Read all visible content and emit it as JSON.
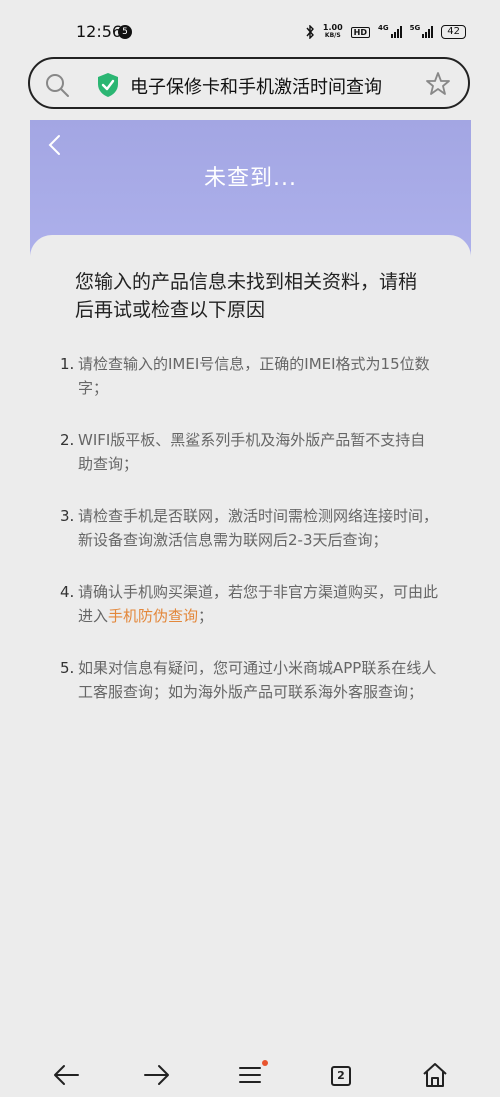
{
  "status_bar": {
    "time": "12:56",
    "notification_count": "5",
    "net_speed": "1.00",
    "net_unit": "KB/S",
    "hd": "HD",
    "sig1": "4G",
    "sig2": "5G",
    "battery": "42"
  },
  "address_bar": {
    "title": "电子保修卡和手机激活时间查询"
  },
  "hero": {
    "title": "未查到..."
  },
  "content": {
    "heading": "您输入的产品信息未找到相关资料，请稍后再试或检查以下原因",
    "items": [
      {
        "num": "1.",
        "text": "请检查输入的IMEI号信息，正确的IMEI格式为15位数字；"
      },
      {
        "num": "2.",
        "text": "WIFI版平板、黑鲨系列手机及海外版产品暂不支持自助查询；"
      },
      {
        "num": "3.",
        "text": "请检查手机是否联网，激活时间需检测网络连接时间，新设备查询激活信息需为联网后2-3天后查询；"
      },
      {
        "num": "4.",
        "text_before": "请确认手机购买渠道，若您于非官方渠道购买，可由此进入",
        "link": "手机防伪查询",
        "text_after": "；"
      },
      {
        "num": "5.",
        "text": "如果对信息有疑问，您可通过小米商城APP联系在线人工客服查询；如为海外版产品可联系海外客服查询；"
      }
    ]
  },
  "bottom_nav": {
    "tabs_count": "2"
  },
  "colors": {
    "hero_top": "#a3a6e3",
    "link": "#e3873a",
    "shield": "#2bb673",
    "badge_dot": "#e8542e"
  }
}
